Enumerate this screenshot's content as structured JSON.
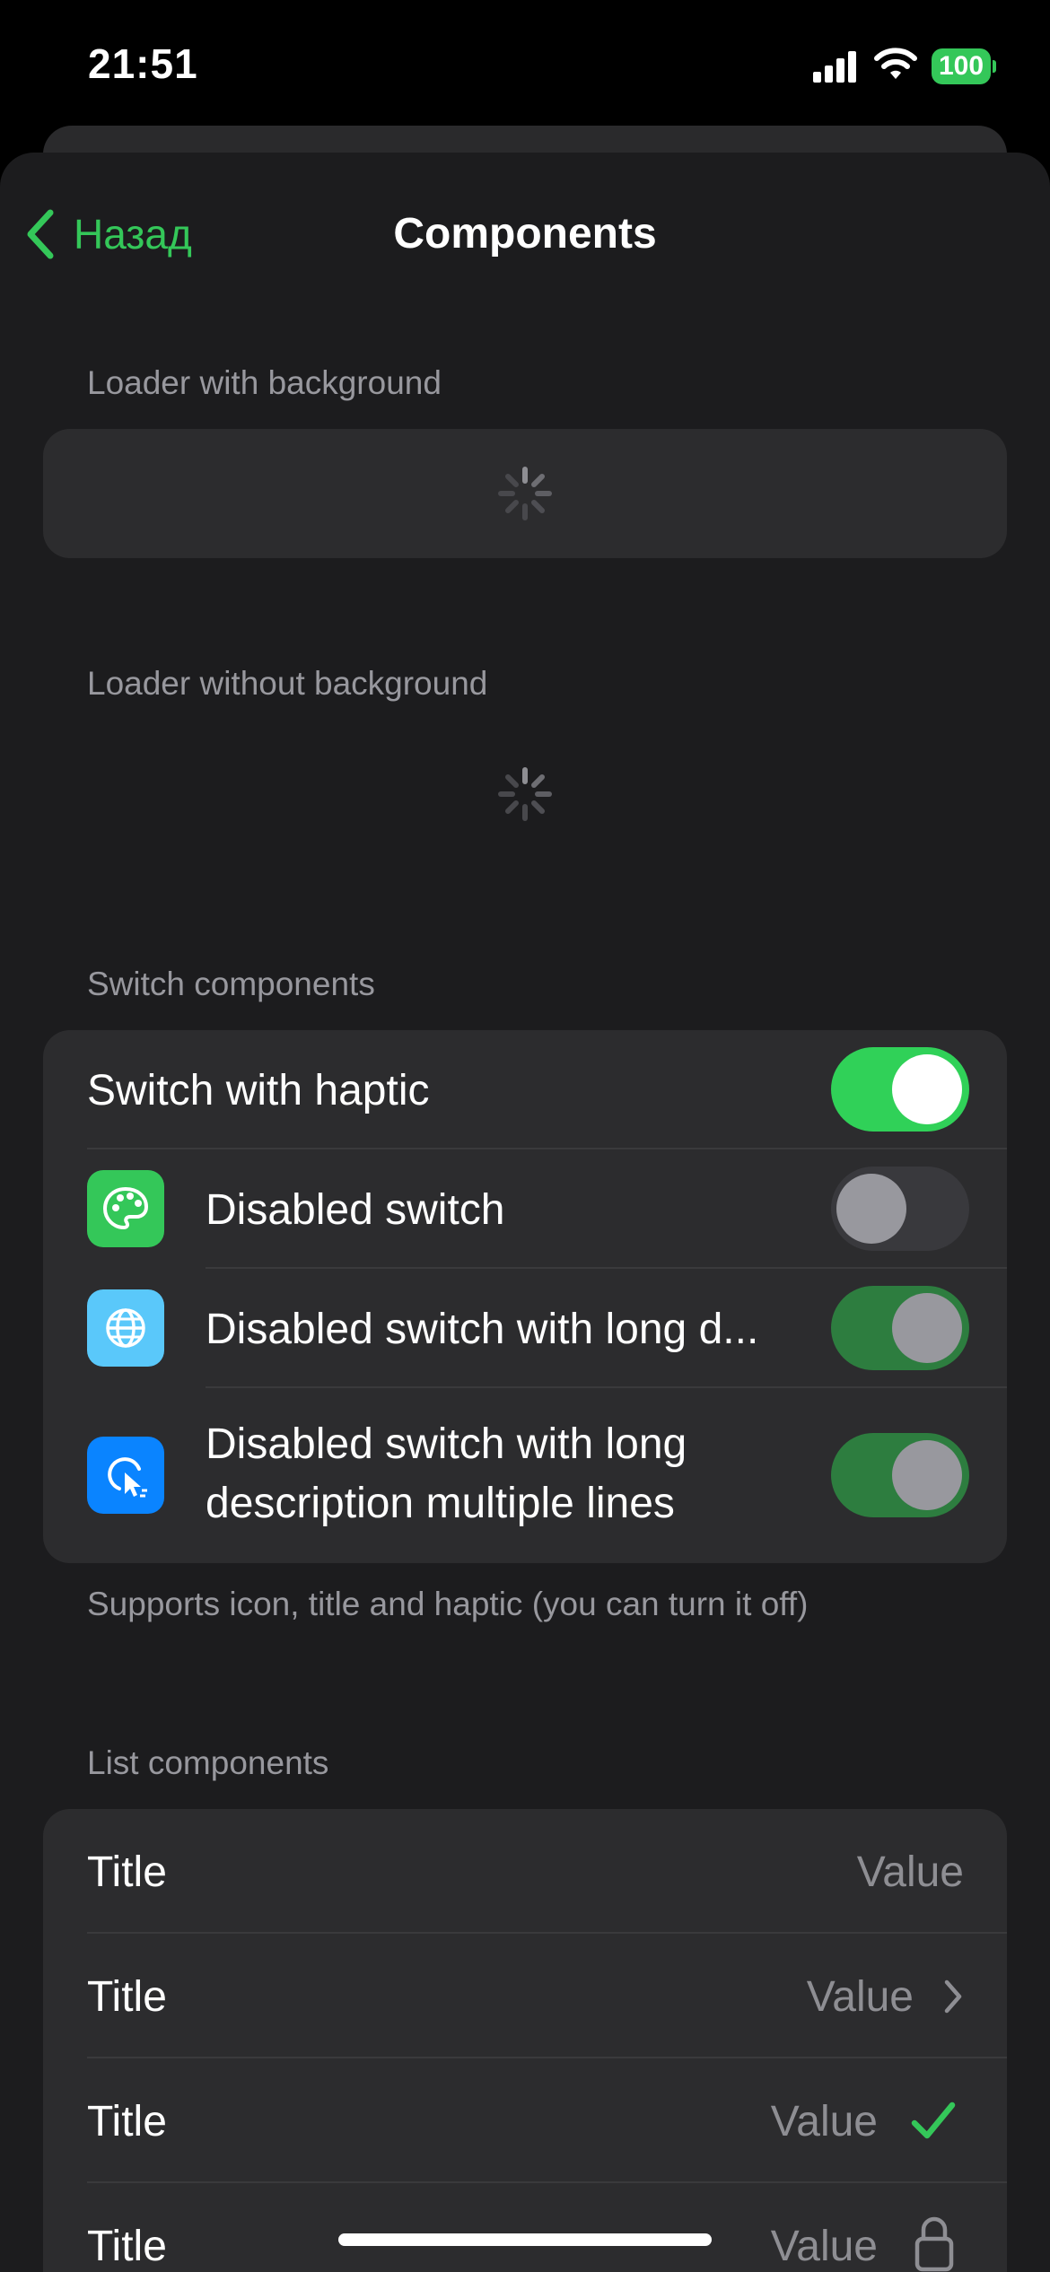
{
  "status_bar": {
    "time": "21:51",
    "battery": "100"
  },
  "nav": {
    "back_label": "Назад",
    "title": "Components"
  },
  "sections": {
    "loader_bg": {
      "header": "Loader with background"
    },
    "loader_no_bg": {
      "header": "Loader without background"
    },
    "switches": {
      "header": "Switch components",
      "footer": "Supports icon, title and haptic (you can turn it off)",
      "items": [
        {
          "title": "Switch with haptic",
          "state": "on",
          "enabled": true
        },
        {
          "title": "Disabled switch",
          "icon": "palette-icon",
          "state": "off",
          "enabled": false
        },
        {
          "title": "Disabled switch with long d...",
          "icon": "globe-icon",
          "state": "on",
          "enabled": false
        },
        {
          "title": "Disabled switch with long description multiple lines",
          "title_line1": "Disabled switch with long",
          "title_line2": "description multiple lines",
          "icon": "cursor-click-icon",
          "state": "on",
          "enabled": false
        }
      ]
    },
    "list": {
      "header": "List components",
      "items": [
        {
          "title": "Title",
          "value": "Value",
          "accessory": "none"
        },
        {
          "title": "Title",
          "value": "Value",
          "accessory": "chevron-icon"
        },
        {
          "title": "Title",
          "value": "Value",
          "accessory": "check-icon"
        },
        {
          "title": "Title",
          "value": "Value",
          "accessory": "lock-icon"
        }
      ]
    }
  },
  "colors": {
    "accent": "#34c759",
    "background": "#1c1c1e",
    "card": "#2c2c2e",
    "secondary_text": "#98989e",
    "switch_on": "#30d158",
    "switch_on_disabled": "#2d7d3f",
    "icon_green": "#34c759",
    "icon_light_blue": "#5ac8fa",
    "icon_blue": "#0a84ff"
  }
}
